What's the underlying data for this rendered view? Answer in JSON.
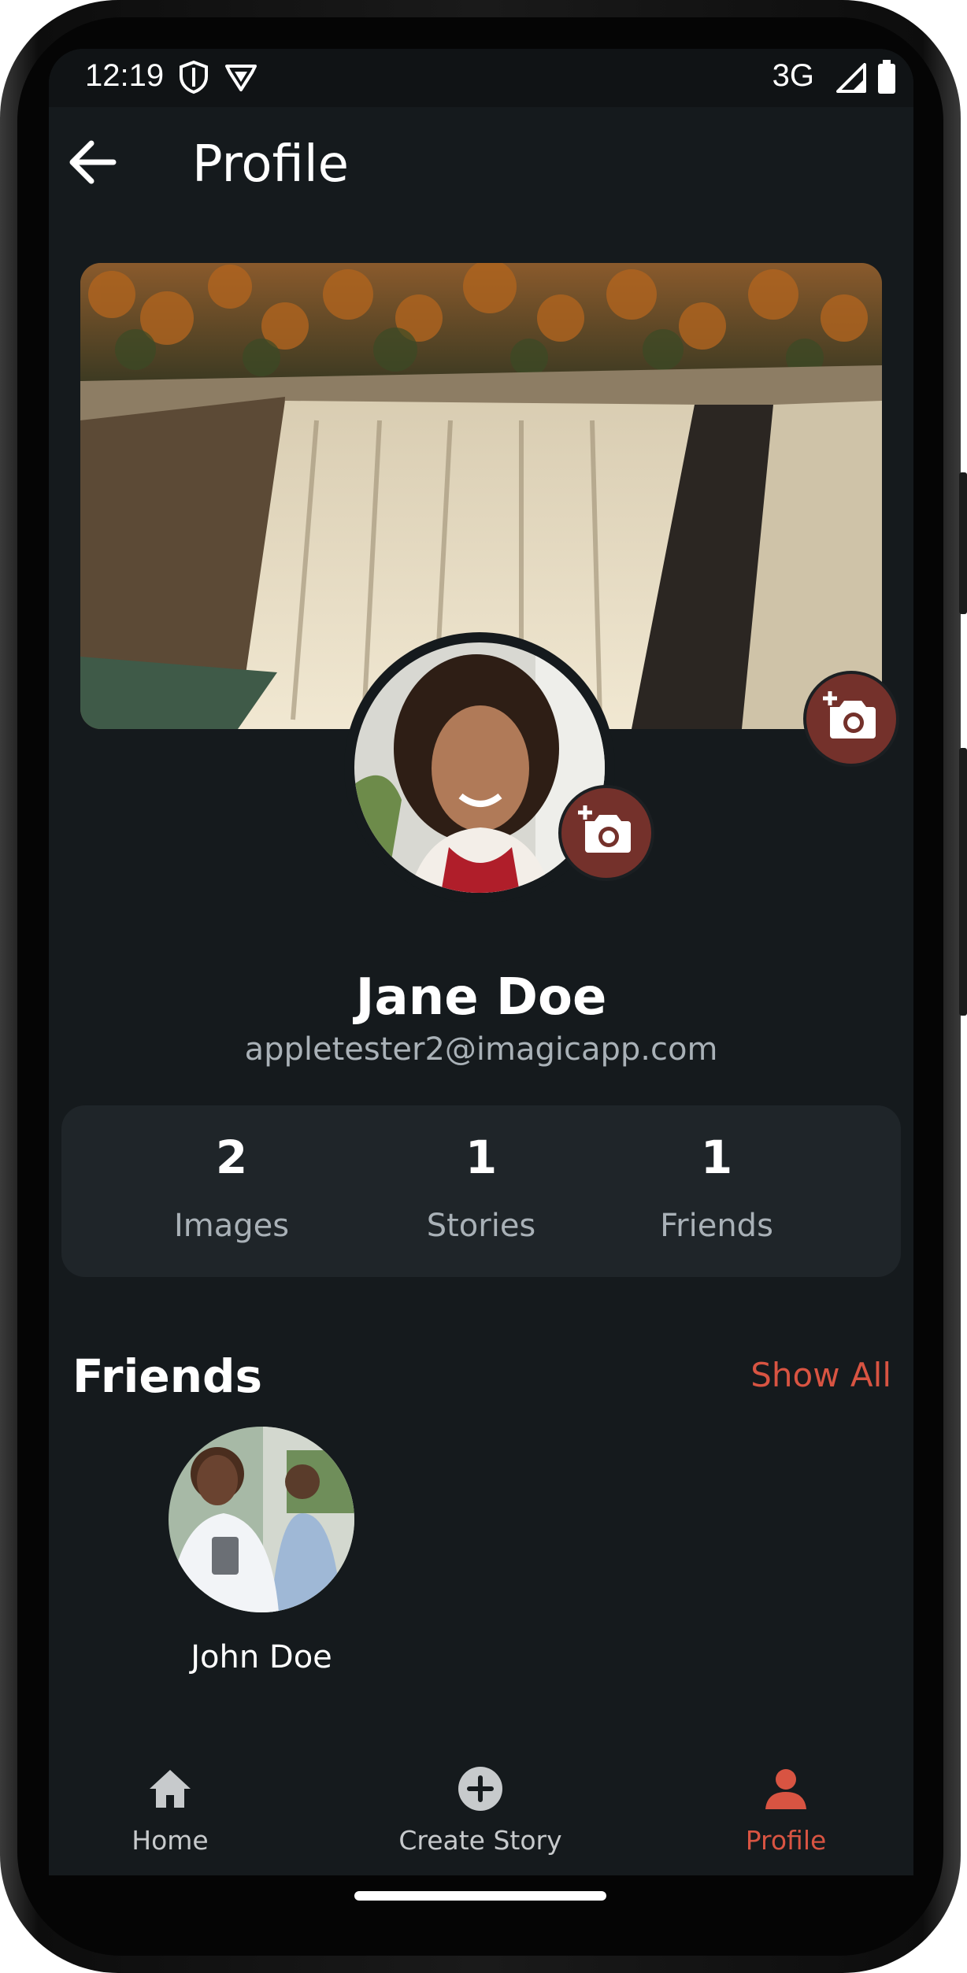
{
  "status_bar": {
    "time": "12:19",
    "network": "3G"
  },
  "header": {
    "title": "Profile"
  },
  "profile": {
    "name": "Jane Doe",
    "email": "appletester2@imagicapp.com"
  },
  "stats": [
    {
      "value": "2",
      "label": "Images"
    },
    {
      "value": "1",
      "label": "Stories"
    },
    {
      "value": "1",
      "label": "Friends"
    }
  ],
  "friends_section": {
    "title": "Friends",
    "show_all_label": "Show All",
    "friends": [
      {
        "name": "John Doe"
      }
    ]
  },
  "bottom_nav": {
    "items": [
      {
        "label": "Home",
        "icon": "home-icon"
      },
      {
        "label": "Create Story",
        "icon": "add-circle-icon"
      },
      {
        "label": "Profile",
        "icon": "person-icon",
        "active": true
      }
    ]
  },
  "colors": {
    "background": "#151a1d",
    "card": "#1f2529",
    "accent": "#d85442",
    "camera_badge": "#74312b",
    "muted_text": "#a9b1b7",
    "inactive_nav": "#c7cacc"
  }
}
